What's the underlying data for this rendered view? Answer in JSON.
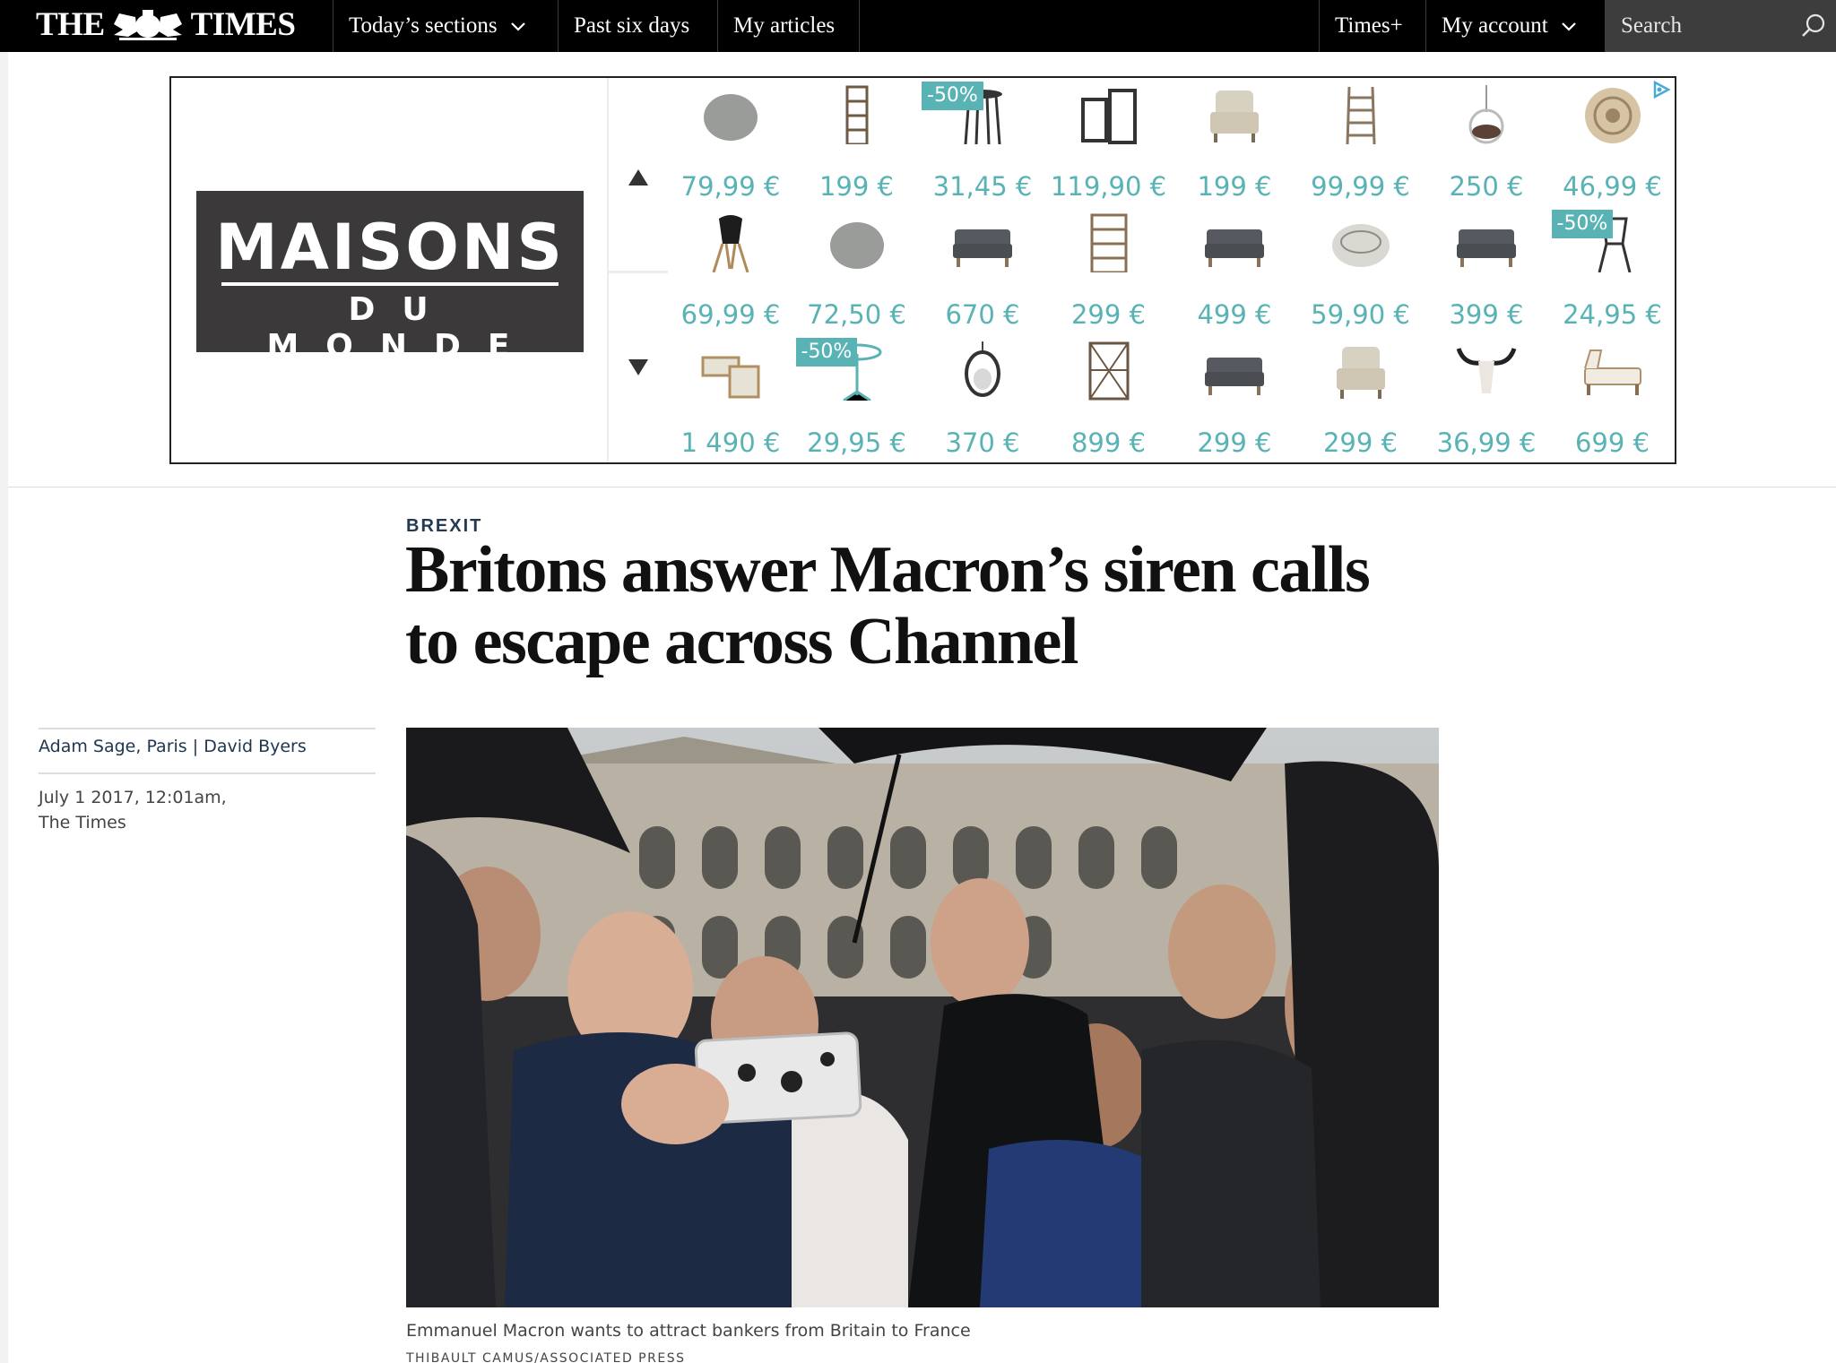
{
  "nav": {
    "logo_left": "THE",
    "logo_right": "TIMES",
    "items": [
      {
        "label": "Today’s sections",
        "dropdown": true
      },
      {
        "label": "Past six days",
        "dropdown": false
      },
      {
        "label": "My articles",
        "dropdown": false
      },
      {
        "label": "Times+",
        "dropdown": false
      },
      {
        "label": "My account",
        "dropdown": true
      }
    ],
    "search_label": "Search"
  },
  "ad": {
    "brand_line1": "MAISONS",
    "brand_line2": "DU MONDE",
    "accent_color": "#59b3b5",
    "badge_text": "-50%",
    "products": [
      {
        "price": "79,99 €",
        "icon": "pouf-icon",
        "badge": false
      },
      {
        "price": "199 €",
        "icon": "shelf-icon",
        "badge": false
      },
      {
        "price": "31,45 €",
        "icon": "bar-stool-icon",
        "badge": true
      },
      {
        "price": "119,90 €",
        "icon": "lantern-icon",
        "badge": false
      },
      {
        "price": "199 €",
        "icon": "armchair-icon",
        "badge": false
      },
      {
        "price": "99,99 €",
        "icon": "ladder-icon",
        "badge": false
      },
      {
        "price": "250 €",
        "icon": "hanging-chair-icon",
        "badge": false
      },
      {
        "price": "46,99 €",
        "icon": "round-rug-icon",
        "badge": false
      },
      {
        "price": "69,99 €",
        "icon": "chair-icon",
        "badge": false
      },
      {
        "price": "72,50 €",
        "icon": "pouf-icon",
        "badge": false
      },
      {
        "price": "670 €",
        "icon": "sofa-icon",
        "badge": false
      },
      {
        "price": "299 €",
        "icon": "bookcase-icon",
        "badge": false
      },
      {
        "price": "499 €",
        "icon": "sofa-icon",
        "badge": false
      },
      {
        "price": "59,90 €",
        "icon": "floor-cushion-icon",
        "badge": false
      },
      {
        "price": "399 €",
        "icon": "sofa-icon",
        "badge": false
      },
      {
        "price": "24,95 €",
        "icon": "garden-chair-icon",
        "badge": true
      },
      {
        "price": "1 490 €",
        "icon": "corner-sofa-icon",
        "badge": false
      },
      {
        "price": "29,95 €",
        "icon": "bistro-table-icon",
        "badge": true
      },
      {
        "price": "370 €",
        "icon": "egg-chair-icon",
        "badge": false
      },
      {
        "price": "899 €",
        "icon": "cabinet-icon",
        "badge": false
      },
      {
        "price": "299 €",
        "icon": "sofa-icon",
        "badge": false
      },
      {
        "price": "299 €",
        "icon": "armchair-icon",
        "badge": false
      },
      {
        "price": "36,99 €",
        "icon": "bull-skull-icon",
        "badge": false
      },
      {
        "price": "699 €",
        "icon": "daybed-icon",
        "badge": false
      }
    ]
  },
  "article": {
    "section": "BREXIT",
    "headline_line1": "Britons answer Macron’s siren calls",
    "headline_line2": "to escape across Channel",
    "author1": "Adam Sage, Paris",
    "author_sep": "|",
    "author2": "David Byers",
    "date": "July 1 2017, 12:01am,",
    "publication": "The Times",
    "caption": "Emmanuel Macron wants to attract bankers from Britain to France",
    "credit": "THIBAULT CAMUS/ASSOCIATED PRESS"
  }
}
